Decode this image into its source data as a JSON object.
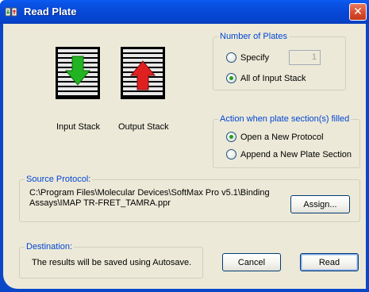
{
  "window": {
    "title": "Read Plate",
    "close_glyph": "✕"
  },
  "stacks": {
    "input_label": "Input Stack",
    "output_label": "Output Stack",
    "input_arrow_color": "#22b322",
    "output_arrow_color": "#e02020"
  },
  "number_of_plates": {
    "label": "Number of Plates",
    "specify_label": "Specify",
    "specify_value": "1",
    "all_label": "All of Input Stack",
    "selected": "all"
  },
  "action": {
    "label": "Action when plate section(s) filled",
    "open_label": "Open a New Protocol",
    "append_label": "Append a New Plate Section",
    "selected": "open"
  },
  "source": {
    "label": "Source Protocol:",
    "path_line1": "C:\\Program Files\\Molecular Devices\\SoftMax Pro v5.1\\Binding",
    "path_line2": "Assays\\IMAP TR-FRET_TAMRA.ppr",
    "assign_label": "Assign..."
  },
  "destination": {
    "label": "Destination:",
    "text": "The results will be saved using Autosave."
  },
  "buttons": {
    "cancel_label": "Cancel",
    "read_label": "Read"
  }
}
